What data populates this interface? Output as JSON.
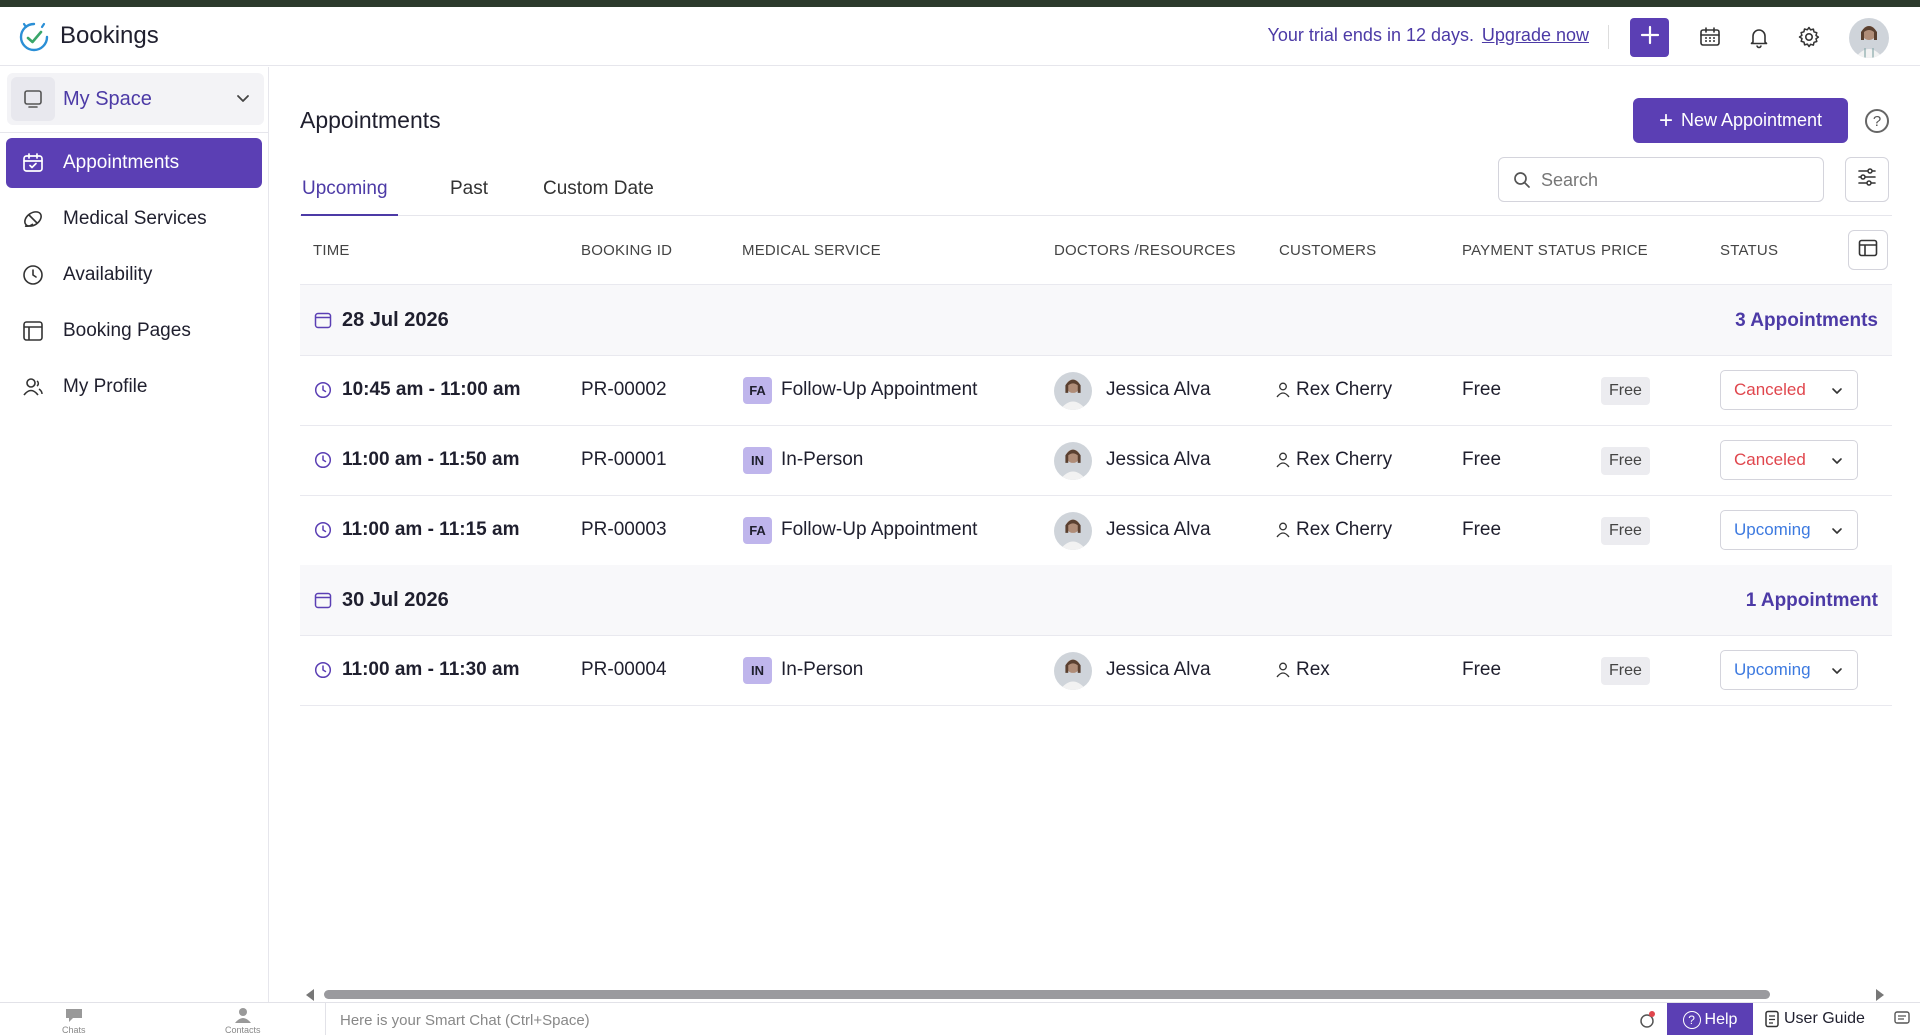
{
  "app": {
    "title": "Bookings"
  },
  "header": {
    "trial_text": "Your trial ends in 12 days.",
    "upgrade_label": "Upgrade now",
    "icons": [
      "plus-icon",
      "calendar-icon",
      "bell-icon",
      "gear-icon",
      "user-avatar"
    ]
  },
  "sidebar": {
    "workspace": "My Space",
    "items": [
      {
        "label": "Appointments",
        "icon": "calendar-check-icon",
        "active": true
      },
      {
        "label": "Medical Services",
        "icon": "pill-icon",
        "active": false
      },
      {
        "label": "Availability",
        "icon": "clock-icon",
        "active": false
      },
      {
        "label": "Booking Pages",
        "icon": "layout-icon",
        "active": false
      },
      {
        "label": "My Profile",
        "icon": "profile-icon",
        "active": false
      }
    ]
  },
  "main": {
    "title": "Appointments",
    "new_button": "New Appointment",
    "tabs": [
      {
        "label": "Upcoming",
        "active": true
      },
      {
        "label": "Past",
        "active": false
      },
      {
        "label": "Custom Date",
        "active": false
      }
    ],
    "search_placeholder": "Search",
    "columns": [
      "TIME",
      "BOOKING ID",
      "MEDICAL SERVICE",
      "DOCTORS /RESOURCES",
      "CUSTOMERS",
      "PAYMENT STATUS",
      "PRICE",
      "STATUS"
    ],
    "groups": [
      {
        "date": "28 Jul 2026",
        "count_label": "3 Appointments",
        "rows": [
          {
            "time": "10:45 am - 11:00 am",
            "booking_id": "PR-00002",
            "service_badge": "FA",
            "service": "Follow-Up Appointment",
            "doctor": "Jessica Alva",
            "customer": "Rex Cherry",
            "payment": "Free",
            "price": "Free",
            "status": "Canceled"
          },
          {
            "time": "11:00 am - 11:50 am",
            "booking_id": "PR-00001",
            "service_badge": "IN",
            "service": "In-Person",
            "doctor": "Jessica Alva",
            "customer": "Rex Cherry",
            "payment": "Free",
            "price": "Free",
            "status": "Canceled"
          },
          {
            "time": "11:00 am - 11:15 am",
            "booking_id": "PR-00003",
            "service_badge": "FA",
            "service": "Follow-Up Appointment",
            "doctor": "Jessica Alva",
            "customer": "Rex Cherry",
            "payment": "Free",
            "price": "Free",
            "status": "Upcoming"
          }
        ]
      },
      {
        "date": "30 Jul 2026",
        "count_label": "1 Appointment",
        "rows": [
          {
            "time": "11:00 am - 11:30 am",
            "booking_id": "PR-00004",
            "service_badge": "IN",
            "service": "In-Person",
            "doctor": "Jessica Alva",
            "customer": "Rex",
            "payment": "Free",
            "price": "Free",
            "status": "Upcoming"
          }
        ]
      }
    ]
  },
  "bottombar": {
    "chats_label": "Chats",
    "contacts_label": "Contacts",
    "smartchat_placeholder": "Here is your Smart Chat (Ctrl+Space)",
    "help_label": "Help",
    "guide_label": "User Guide"
  },
  "colors": {
    "accent": "#5b3fb4",
    "accent_text": "#4c3aa6",
    "canceled": "#e0464d",
    "upcoming": "#3d7ae0"
  }
}
